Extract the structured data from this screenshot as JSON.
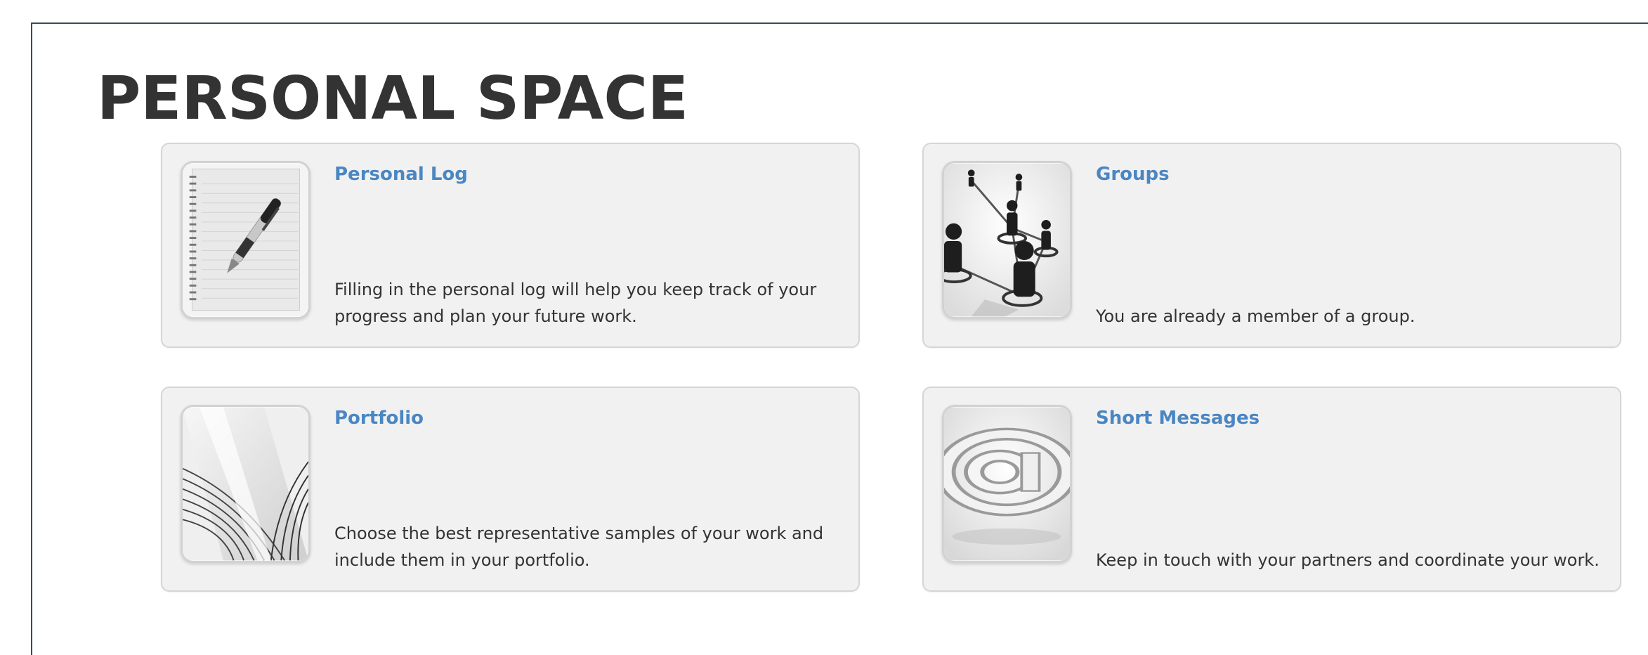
{
  "page": {
    "title": "PERSONAL SPACE"
  },
  "cards": [
    {
      "title": "Personal Log",
      "description": "Filling in the personal log will help you keep track of your progress and plan your future work.",
      "icon": "notebook-pen-icon"
    },
    {
      "title": "Groups",
      "description": "You are already a member of a group.",
      "icon": "network-people-icon"
    },
    {
      "title": "Portfolio",
      "description": "Choose the best representative samples of your work and include them in your portfolio.",
      "icon": "open-book-icon"
    },
    {
      "title": "Short Messages",
      "description": "Keep in touch with your partners and coordinate your work.",
      "icon": "at-sign-icon"
    }
  ],
  "colors": {
    "title_text": "#333333",
    "link_blue": "#4a86c2",
    "card_bg": "#f1f1f1",
    "card_border": "#d6d6d6",
    "frame_border": "#2f4f5f"
  }
}
